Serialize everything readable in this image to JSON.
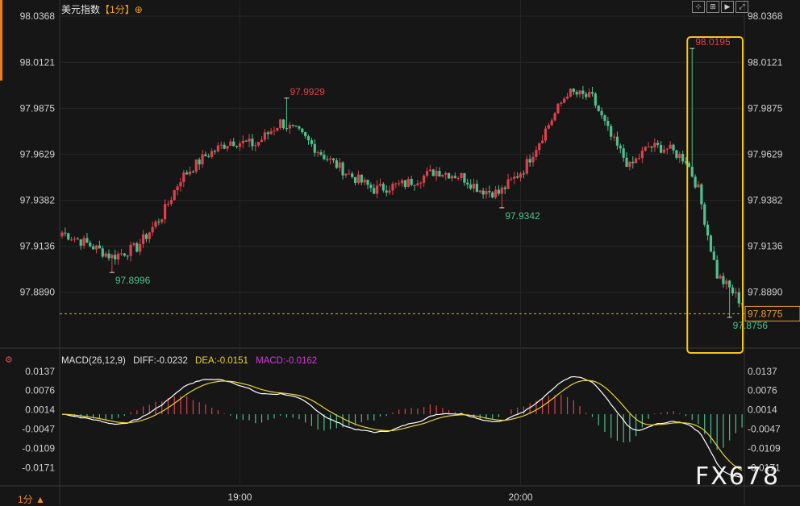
{
  "header": {
    "symbol": "美元指数",
    "interval": "【1分】",
    "interval_icon": "target-icon"
  },
  "toolbar": {
    "icons": [
      "crosshair-icon",
      "zoom-in-icon",
      "play-icon",
      "fullscreen-icon"
    ]
  },
  "footer": {
    "interval_label": "1分 ▲"
  },
  "watermark": "FX678",
  "colors": {
    "up": "#e0404b",
    "down": "#4fc08d",
    "dif": "#ffffff",
    "dea": "#e6d23c",
    "highlight": "#f5c518",
    "last": "#f0a030"
  },
  "chart_data": [
    {
      "type": "candlestick",
      "title": "",
      "y_ticks": [
        "98.0368",
        "98.0121",
        "97.9875",
        "97.9629",
        "97.9382",
        "97.9136",
        "97.8890"
      ],
      "ylim": [
        97.8643,
        98.0368
      ],
      "x_ticks": [
        "19:00",
        "20:00"
      ],
      "current_price": "97.8775",
      "annotations": [
        {
          "label": "97.8996",
          "value": 97.8996,
          "kind": "low"
        },
        {
          "label": "97.9929",
          "value": 97.9929,
          "kind": "high"
        },
        {
          "label": "97.9342",
          "value": 97.9342,
          "kind": "low"
        },
        {
          "label": "98.0195",
          "value": 98.0195,
          "kind": "high"
        },
        {
          "label": "97.8756",
          "value": 97.8756,
          "kind": "low"
        }
      ],
      "anchors": [
        {
          "i": 0,
          "v": 97.921
        },
        {
          "i": 8,
          "v": 97.915
        },
        {
          "i": 16,
          "v": 97.908
        },
        {
          "i": 24,
          "v": 97.913
        },
        {
          "i": 32,
          "v": 97.93
        },
        {
          "i": 38,
          "v": 97.95
        },
        {
          "i": 46,
          "v": 97.962
        },
        {
          "i": 54,
          "v": 97.97
        },
        {
          "i": 62,
          "v": 97.968
        },
        {
          "i": 70,
          "v": 97.98
        },
        {
          "i": 76,
          "v": 97.974
        },
        {
          "i": 84,
          "v": 97.962
        },
        {
          "i": 92,
          "v": 97.952
        },
        {
          "i": 100,
          "v": 97.944
        },
        {
          "i": 110,
          "v": 97.947
        },
        {
          "i": 120,
          "v": 97.954
        },
        {
          "i": 128,
          "v": 97.951
        },
        {
          "i": 134,
          "v": 97.944
        },
        {
          "i": 140,
          "v": 97.942
        },
        {
          "i": 148,
          "v": 97.955
        },
        {
          "i": 155,
          "v": 97.976
        },
        {
          "i": 162,
          "v": 97.996
        },
        {
          "i": 170,
          "v": 97.993
        },
        {
          "i": 176,
          "v": 97.972
        },
        {
          "i": 182,
          "v": 97.956
        },
        {
          "i": 188,
          "v": 97.967
        },
        {
          "i": 194,
          "v": 97.966
        },
        {
          "i": 200,
          "v": 97.96
        },
        {
          "i": 204,
          "v": 97.944
        },
        {
          "i": 207,
          "v": 97.92
        },
        {
          "i": 210,
          "v": 97.898
        },
        {
          "i": 214,
          "v": 97.891
        },
        {
          "i": 218,
          "v": 97.883
        }
      ],
      "extremes": [
        {
          "i": 16,
          "v": 97.8996,
          "side": "low"
        },
        {
          "i": 72,
          "v": 97.9929,
          "side": "high"
        },
        {
          "i": 141,
          "v": 97.9342,
          "side": "low"
        },
        {
          "i": 202,
          "v": 98.0195,
          "side": "high"
        },
        {
          "i": 214,
          "v": 97.8756,
          "side": "low"
        }
      ],
      "bars": 219,
      "time_ticks": [
        {
          "label": "19:00",
          "i": 57
        },
        {
          "label": "20:00",
          "i": 147
        }
      ],
      "highlight_from_bar": 202
    },
    {
      "type": "macd",
      "legend": {
        "name": "MACD(26,12,9)",
        "diff": "DIFF:-0.0232",
        "dea": "DEA:-0.0151",
        "macd": "MACD:-0.0162"
      },
      "y_ticks": [
        "0.0137",
        "0.0076",
        "0.0014",
        "-0.0047",
        "-0.0109",
        "-0.0171"
      ],
      "ylim": [
        -0.0232,
        0.0137
      ]
    }
  ]
}
